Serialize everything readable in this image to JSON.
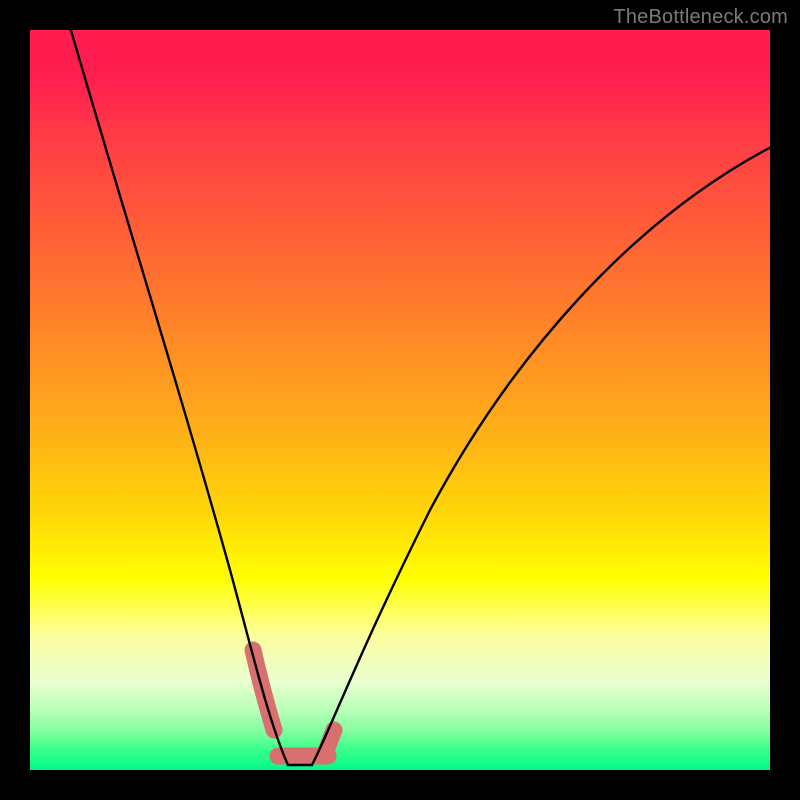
{
  "watermark": "TheBottleneck.com",
  "colors": {
    "frame": "#000000",
    "curve": "#000000",
    "highlight": "#d97070",
    "gradient_top": "#ff1d4f",
    "gradient_bottom": "#00fa88"
  },
  "chart_data": {
    "type": "line",
    "title": "",
    "xlabel": "",
    "ylabel": "",
    "xlim": [
      0,
      100
    ],
    "ylim": [
      0,
      100
    ],
    "grid": false,
    "description": "V-shaped bottleneck curve over a red→yellow→green vertical gradient. Curve minimum sits near x≈35, y≈0. Left branch rises steeply to top-left corner; right branch rises more gently toward upper right.",
    "series": [
      {
        "name": "bottleneck",
        "x": [
          4,
          8,
          12,
          16,
          20,
          24,
          27,
          29,
          31,
          32,
          33,
          34,
          35,
          36,
          37,
          38,
          39,
          41,
          44,
          50,
          58,
          68,
          80,
          94,
          100
        ],
        "y": [
          100,
          88,
          76,
          64,
          52,
          40,
          28,
          20,
          12,
          8,
          4,
          2,
          0,
          0,
          1,
          2,
          3,
          6,
          12,
          22,
          34,
          48,
          62,
          78,
          84
        ]
      }
    ],
    "highlight_segments": [
      {
        "note": "short thick pink marks tracing the bottom of the V",
        "points": [
          {
            "x": 30.5,
            "y": 15
          },
          {
            "x": 31.5,
            "y": 10
          },
          {
            "x": 32.5,
            "y": 5
          },
          {
            "x": 33.5,
            "y": 2
          },
          {
            "x": 35,
            "y": 0.5
          },
          {
            "x": 37,
            "y": 0.5
          },
          {
            "x": 38.5,
            "y": 1.5
          },
          {
            "x": 39.5,
            "y": 3.5
          }
        ]
      }
    ]
  }
}
